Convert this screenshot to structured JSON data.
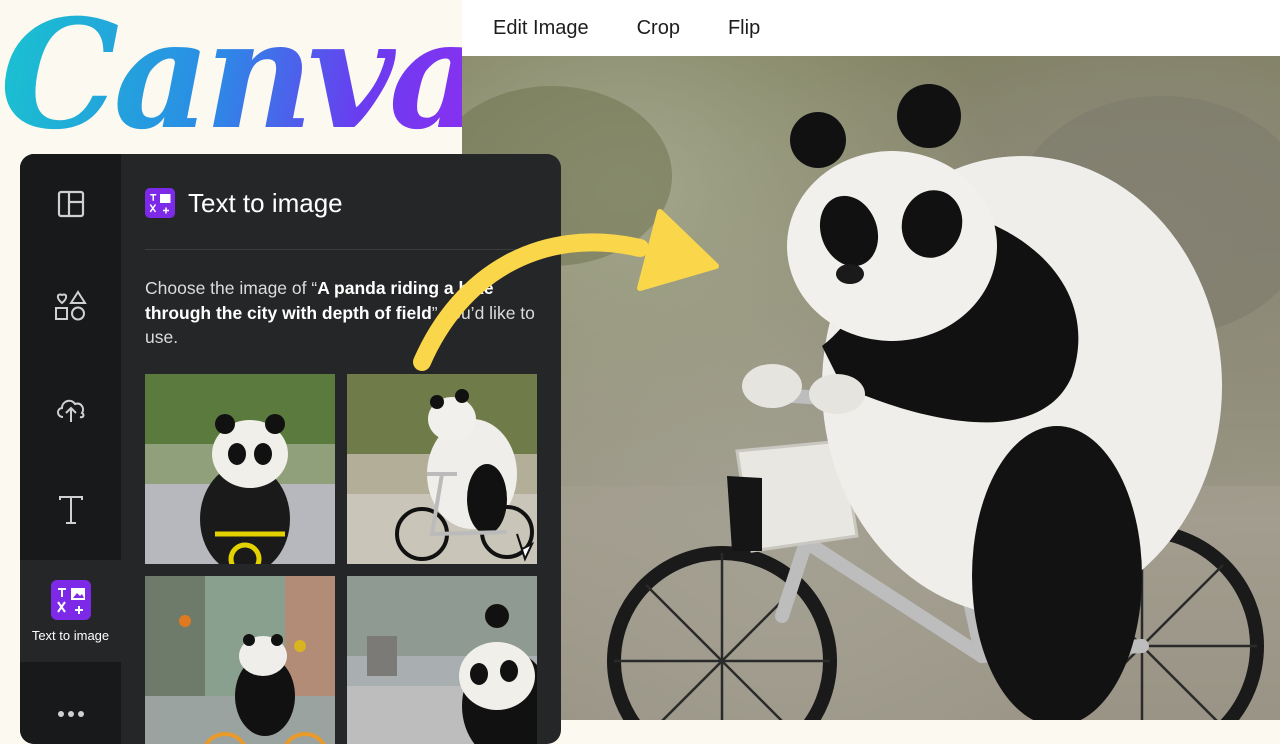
{
  "logo": {
    "text": "Canva"
  },
  "toolbar": {
    "edit_image": "Edit Image",
    "crop": "Crop",
    "flip": "Flip"
  },
  "panel": {
    "title": "Text to image",
    "description_prefix": "Choose the image of “",
    "description_prompt": "A panda riding a bike through the city with depth of field",
    "description_suffix": "” you’d like to use.",
    "rail": {
      "items": [
        {
          "icon": "layout-icon",
          "label": ""
        },
        {
          "icon": "elements-icon",
          "label": ""
        },
        {
          "icon": "upload-cloud-icon",
          "label": ""
        },
        {
          "icon": "text-icon",
          "label": ""
        },
        {
          "icon": "text-to-image-icon",
          "label": "Text to image"
        },
        {
          "icon": "more-icon",
          "label": ""
        }
      ]
    },
    "thumbnails": [
      {
        "name": "panda-front-yellow-bike"
      },
      {
        "name": "panda-side-silver-bike"
      },
      {
        "name": "panda-orange-bike-street"
      },
      {
        "name": "panda-closeup-city"
      }
    ]
  },
  "annotation": {
    "arrow_color": "#f9d64a"
  },
  "colors": {
    "panel_bg": "#252627",
    "rail_bg": "#18191b",
    "accent_purple": "#7d2ae8"
  }
}
